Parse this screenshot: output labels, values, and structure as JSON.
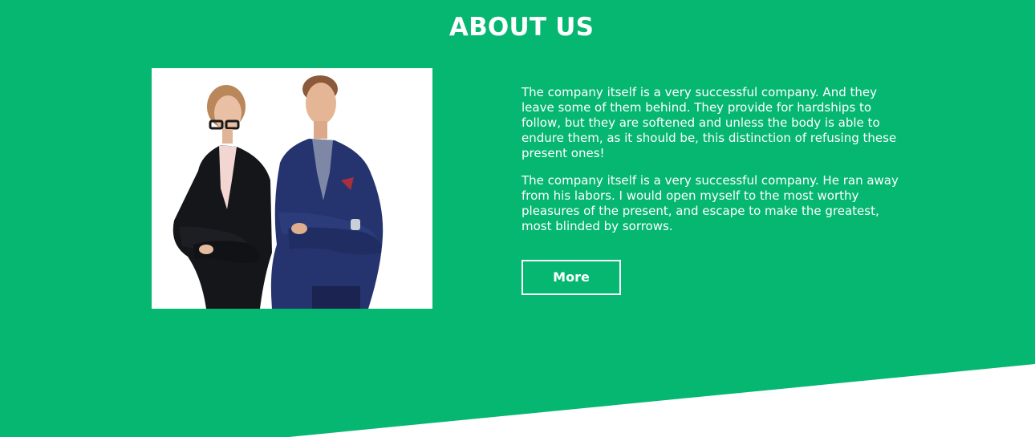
{
  "colors": {
    "section_background": "#06b771",
    "lower_background": "#ffffff",
    "text": "#ffffff"
  },
  "about": {
    "title": "ABOUT US",
    "image": "business-team-photo",
    "paragraphs": [
      "The company itself is a very successful company. And they leave some of them behind. They provide for hardships to follow, but they are softened and unless the body is able to endure them, as it should be, this distinction of refusing these present ones!",
      "The company itself is a very successful company. He ran away from his labors. I would open myself to the most worthy pleasures of the present, and escape to make the greatest, most blinded by sorrows."
    ],
    "more_label": "More"
  }
}
